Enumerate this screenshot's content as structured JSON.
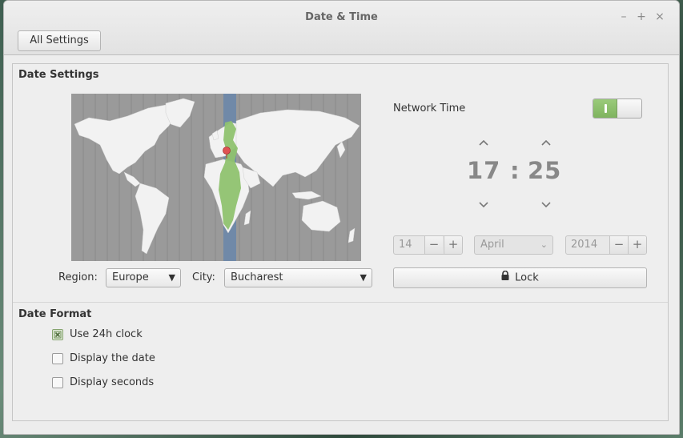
{
  "window": {
    "title": "Date & Time",
    "controls": {
      "minimize": "–",
      "maximize": "+",
      "close": "×"
    }
  },
  "toolbar": {
    "all_settings_label": "All Settings"
  },
  "date_settings": {
    "section_title": "Date Settings",
    "region_label": "Region:",
    "region_value": "Europe",
    "city_label": "City:",
    "city_value": "Bucharest",
    "network_time_label": "Network Time",
    "network_time_on": true,
    "hour": "17",
    "separator": ":",
    "minute": "25",
    "day": "14",
    "month": "April",
    "year": "2014",
    "lock_label": "Lock"
  },
  "date_format": {
    "section_title": "Date Format",
    "options": [
      {
        "label": "Use 24h clock",
        "checked": true
      },
      {
        "label": "Display the date",
        "checked": false
      },
      {
        "label": "Display seconds",
        "checked": false
      }
    ]
  },
  "icons": {
    "lock": "lock-icon",
    "up": "chevron-up-icon",
    "down": "chevron-down-icon"
  },
  "colors": {
    "accent_green": "#8fc26f",
    "map_ocean": "#9a9a9a",
    "map_land": "#f2f2f2",
    "timezone_band": "#7089a8",
    "location_pin": "#e05252"
  }
}
